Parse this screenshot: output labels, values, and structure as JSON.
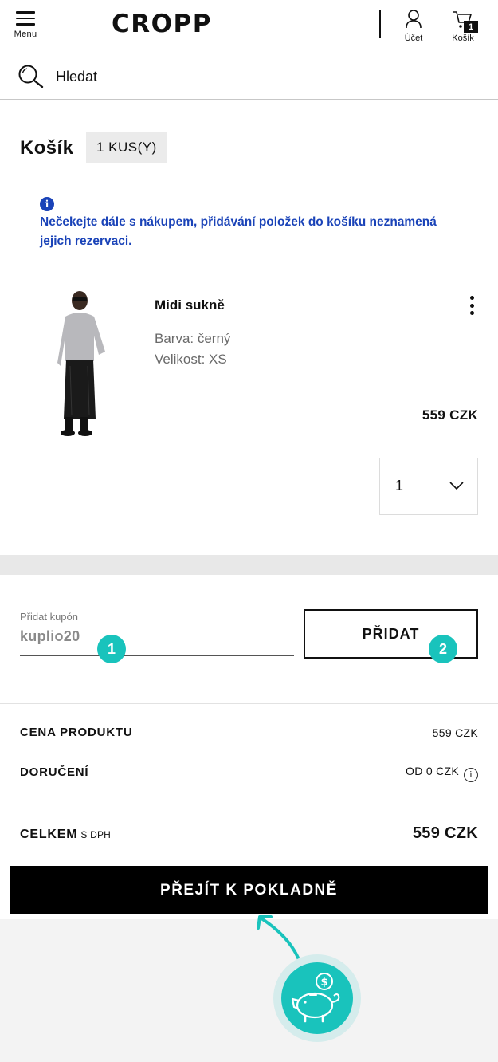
{
  "header": {
    "menu_label": "Menu",
    "logo": "CROPP",
    "account_label": "Účet",
    "cart_label": "Košík",
    "cart_count": "1"
  },
  "search": {
    "placeholder": "Hledat"
  },
  "cart": {
    "title": "Košík",
    "items_badge": "1 KUS(Y)",
    "notice": "Nečekejte dále s nákupem, přidávání položek do košíku neznamená jejich rezervaci."
  },
  "product": {
    "name": "Midi sukně",
    "color": "Barva: černý",
    "size": "Velikost: XS",
    "price": "559 CZK",
    "quantity": "1"
  },
  "coupon": {
    "label": "Přidat kupón",
    "value": "kuplio20",
    "button": "PŘIDAT",
    "step1": "1",
    "step2": "2"
  },
  "summary": {
    "product_price_label": "CENA PRODUKTU",
    "product_price_value": "559 CZK",
    "delivery_label": "DORUČENÍ",
    "delivery_value": "OD 0 CZK",
    "total_label": "CELKEM",
    "total_suffix": "S DPH",
    "total_value": "559 CZK"
  },
  "checkout": {
    "button": "PŘEJÍT K POKLADNĚ"
  },
  "colors": {
    "accent_teal": "#19c3bc",
    "notice_blue": "#1a43b8",
    "primary_black": "#000000"
  }
}
